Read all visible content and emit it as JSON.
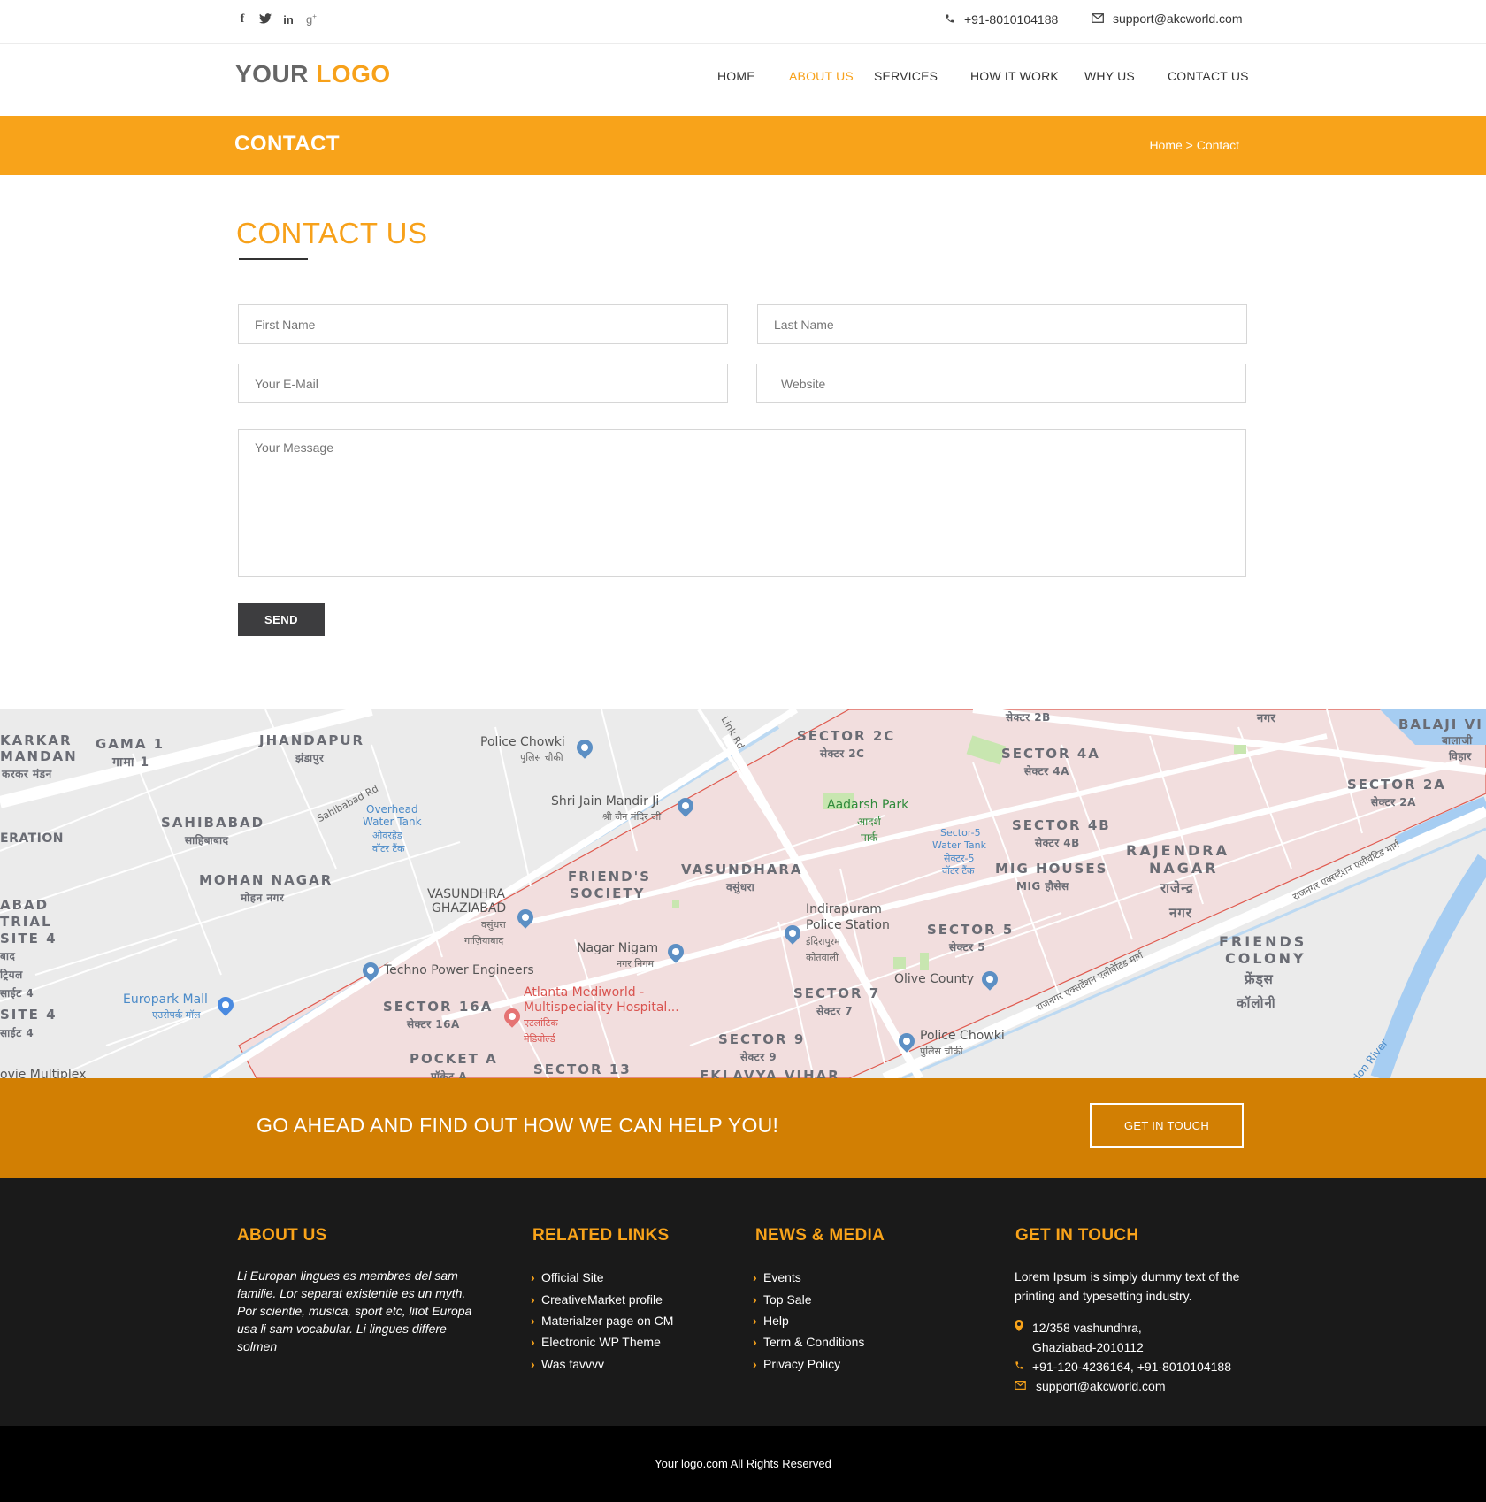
{
  "topbar": {
    "social_icons": [
      "facebook-icon",
      "twitter-icon",
      "linkedin-icon",
      "google-plus-icon"
    ],
    "phone": "+91-8010104188",
    "email": "support@akcworld.com"
  },
  "header": {
    "logo_part1": "YOUR",
    "logo_part2": "LOGO",
    "nav": [
      {
        "label": "HOME",
        "active": false
      },
      {
        "label": "ABOUT US",
        "active": true
      },
      {
        "label": "SERVICES",
        "active": false
      },
      {
        "label": "HOW IT WORK",
        "active": false
      },
      {
        "label": "WHY US",
        "active": false
      },
      {
        "label": "CONTACT US",
        "active": false
      }
    ]
  },
  "title_band": {
    "title": "CONTACT",
    "breadcrumb": "Home > Contact"
  },
  "contact": {
    "heading": "CONTACT US",
    "first_name_placeholder": "First Name",
    "last_name_placeholder": "Last Name",
    "email_placeholder": "Your E-Mail",
    "website_placeholder": "Website",
    "message_placeholder": "Your Message",
    "send_label": "SEND"
  },
  "map": {
    "labels": {
      "karkar": "KARKAR",
      "mandan": "MANDAN",
      "karkar_hi": "करकर मंडन",
      "gama": "GAMA 1",
      "gama_hi": "गामा 1",
      "jhandapur": "JHANDAPUR",
      "jhandapur_hi": "झंडापुर",
      "police_chowki_1": "Police Chowki",
      "police_chowki_1_hi": "पुलिस चौकी",
      "link_rd": "Link Rd",
      "sector2b_hi": "सेक्टर 2B",
      "nagar_hi": "नगर",
      "balaji": "BALAJI VI",
      "balaji_hi": "बालाजी",
      "vihar_hi": "विहार",
      "sector2c": "SECTOR 2C",
      "sector2c_hi": "सेक्टर 2C",
      "sector4a": "SECTOR 4A",
      "sector4a_hi": "सेक्टर 4A",
      "sector2a": "SECTOR 2A",
      "sector2a_hi": "सेक्टर 2A",
      "eration": "ERATION",
      "sahibabad": "SAHIBABAD",
      "sahibabad_hi": "साहिबाबाद",
      "sahibabad_rd": "Sahibabad Rd",
      "overhead_tank": "Overhead",
      "overhead_tank_2": "Water Tank",
      "overhead_tank_hi": "ओवरहेड",
      "overhead_tank_hi2": "वॉटर टैंक",
      "jain_mandir": "Shri Jain Mandir Ji",
      "jain_mandir_hi": "श्री जैन मंदिर जी",
      "aadarsh_park": "Aadarsh Park",
      "aadarsh_hi": "आदर्श",
      "park_hi": "पार्क",
      "sector4b": "SECTOR 4B",
      "sector4b_hi": "सेक्टर 4B",
      "sector5_tank": "Sector-5",
      "sector5_tank_2": "Water Tank",
      "sector5_tank_hi": "सेक्टर-5",
      "sector5_tank_hi2": "वॉटर टैंक",
      "rajendra": "RAJENDRA",
      "rajendra_2": "NAGAR",
      "rajendra_hi": "राजेन्द्र",
      "rajendra_hi2": "नगर",
      "mohan_nagar": "MOHAN NAGAR",
      "mohan_nagar_hi": "मोहन नगर",
      "friends_society": "FRIEND'S",
      "friends_society_2": "SOCIETY",
      "vasundhara": "VASUNDHARA",
      "vasundhara_hi": "वसुंधरा",
      "mig": "MIG HOUSES",
      "mig_hi": "MIG हौसेस",
      "expressway_1": "राजनगर एक्सटेंशन एलीवेटिड मार्ग",
      "abad": "ABAD",
      "trial": "TRIAL",
      "site4": "SITE 4",
      "abad_hi": "बाद",
      "trial_hi": "ट्रियल",
      "site4_hi": "साईट 4",
      "vasundhra_gzb": "VASUNDHRA",
      "vasundhra_gzb_2": "GHAZIABAD",
      "vasundhra_gzb_hi": "वसुंधरा",
      "vasundhra_gzb_hi2": "गाज़ियाबाद",
      "indirapuram": "Indirapuram",
      "indirapuram_2": "Police Station",
      "indirapuram_hi": "इंदिरापुरम",
      "indirapuram_hi2": "कोतवाली",
      "sector5": "SECTOR 5",
      "sector5_hi": "सेक्टर 5",
      "friends_colony": "FRIENDS",
      "friends_colony_2": "COLONY",
      "friends_colony_hi": "फ्रेंड्स",
      "friends_colony_hi2": "कॉलोनी",
      "nagar_nigam": "Nagar Nigam",
      "nagar_nigam_hi": "नगर निगम",
      "techno_power": "Techno Power Engineers",
      "olive_county": "Olive County",
      "site4_b": "SITE 4",
      "site4_b_hi": "साईट 4",
      "europark": "Europark Mall",
      "europark_hi": "एउरोपर्क मॉल",
      "atlanta": "Atlanta Mediworld -",
      "atlanta_2": "Multispeciality Hospital...",
      "atlanta_hi": "एटलांटिक",
      "atlanta_hi2": "मेडिवोर्ल्ड",
      "sector16a": "SECTOR 16A",
      "sector16a_hi": "सेक्टर 16A",
      "sector7": "SECTOR 7",
      "sector7_hi": "सेक्टर 7",
      "expressway_2": "राजनगर एक्सटेंशन एलीवेटिड मार्ग",
      "sector9": "SECTOR 9",
      "sector9_hi": "सेक्टर 9",
      "police_chowki_2": "Police Chowki",
      "police_chowki_2_hi": "पुलिस चौकी",
      "pocket_a": "POCKET A",
      "pocket_a_hi": "पॉकेट A",
      "sector13": "SECTOR 13",
      "eklavya": "EKLAVYA VIHAR",
      "multiplex": "ovie Multiplex",
      "hindon_river": "don River"
    },
    "colors": {
      "land": "#ebebeb",
      "zone": "#f2dede",
      "zone_border": "#e05a4f",
      "road": "#ffffff",
      "water": "#a6cdf2",
      "park": "#c8e6b0"
    }
  },
  "cta": {
    "text": "GO AHEAD AND FIND OUT HOW WE CAN HELP YOU!",
    "button": "GET IN TOUCH"
  },
  "footer": {
    "about": {
      "heading": "ABOUT US",
      "text": "Li Europan lingues es membres del sam familie. Lor separat existentie es un myth. Por scientie, musica, sport etc, litot Europa usa li sam vocabular. Li lingues differe solmen"
    },
    "related": {
      "heading": "RELATED LINKS",
      "links": [
        "Official Site",
        "CreativeMarket profile",
        "Materialzer page on CM",
        "Electronic WP Theme",
        "Was favvvv"
      ]
    },
    "news": {
      "heading": "NEWS & MEDIA",
      "links": [
        "Events",
        "Top Sale",
        "Help",
        "Term & Conditions",
        "Privacy Policy"
      ]
    },
    "touch": {
      "heading": "GET IN TOUCH",
      "text": "Lorem Ipsum is simply dummy text of the printing and typesetting industry.",
      "address_1": "12/358 vashundhra,",
      "address_2": "Ghaziabad-2010112",
      "phone": "+91-120-4236164, +91-8010104188",
      "email": "support@akcworld.com"
    },
    "copyright": "Your logo.com All Rights Reserved"
  }
}
